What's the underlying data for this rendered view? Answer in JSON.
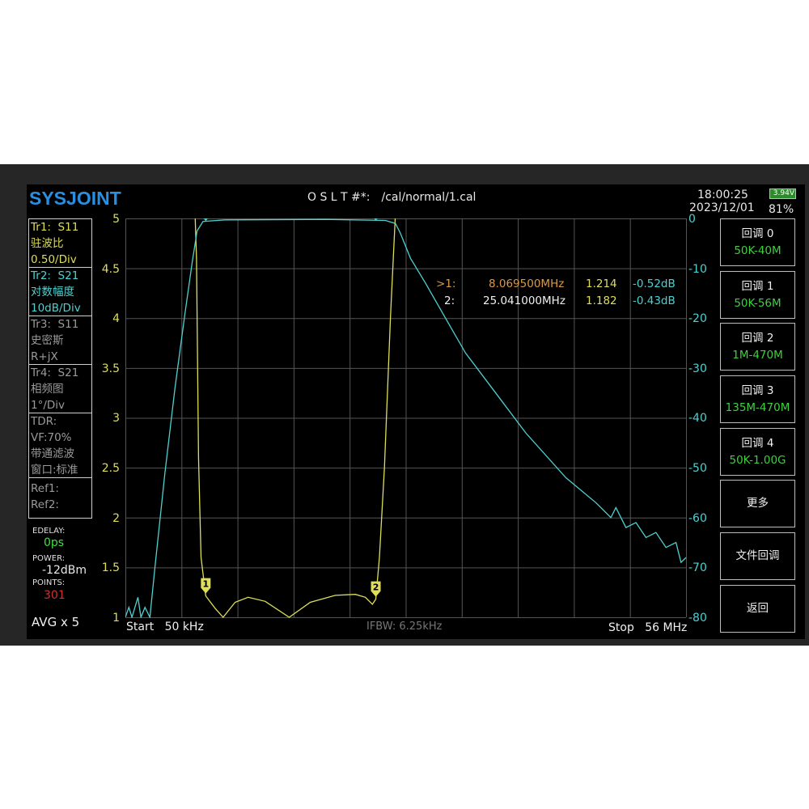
{
  "header": {
    "logo": "SYSJOINT",
    "cal_label": "O S L T #*:",
    "cal_file": "/cal/normal/1.cal",
    "time": "18:00:25",
    "date": "2023/12/01",
    "battery_voltage": "3.94V",
    "battery_percent": "81%"
  },
  "traces": [
    {
      "name": "Tr1:",
      "param": "S11",
      "format": "驻波比",
      "scale": "0.50/Div"
    },
    {
      "name": "Tr2:",
      "param": "S21",
      "format": "对数幅度",
      "scale": "10dB/Div"
    },
    {
      "name": "Tr3:",
      "param": "S11",
      "format": "史密斯",
      "scale": "R+jX"
    },
    {
      "name": "Tr4:",
      "param": "S21",
      "format": "相频图",
      "scale": "1°/Div"
    }
  ],
  "tdr": {
    "title": "TDR:",
    "vf": "VF:70%",
    "mode": "带通滤波",
    "window": "窗口:标准"
  },
  "refs": [
    "Ref1:",
    "Ref2:"
  ],
  "status": {
    "edelay_label": "EDELAY:",
    "edelay": "0ps",
    "power_label": "POWER:",
    "power": "-12dBm",
    "points_label": "POINTS:",
    "points": "301",
    "avg": "AVG x 5"
  },
  "markers": [
    {
      "id": ">1:",
      "freq_a": "8.069",
      "freq_b": "500MHz",
      "swr": "1.214",
      "s21": "-0.52dB",
      "label": "1"
    },
    {
      "id": "2:",
      "freq_a": "25.041",
      "freq_b": "000MHz",
      "swr": "1.182",
      "s21": "-0.43dB",
      "label": "2"
    }
  ],
  "footer": {
    "start_label": "Start",
    "start": "50 kHz",
    "ifbw": "IFBW: 6.25kHz",
    "stop_label": "Stop",
    "stop": "56 MHz"
  },
  "buttons": [
    {
      "label": "回调 0",
      "range": "50K-40M"
    },
    {
      "label": "回调 1",
      "range": "50K-56M"
    },
    {
      "label": "回调 2",
      "range": "1M-470M"
    },
    {
      "label": "回调 3",
      "range": "135M-470M"
    },
    {
      "label": "回调 4",
      "range": "50K-1.00G"
    },
    {
      "label": "更多"
    },
    {
      "label": "文件回调"
    },
    {
      "label": "返回"
    }
  ],
  "colors": {
    "s11": "#dede5a",
    "s21": "#4fd0d0",
    "marker1": "#d99a4a",
    "grid": "#555555",
    "logo": "#2a8fe0"
  },
  "chart_data": {
    "type": "line",
    "x_range_mhz": [
      0.05,
      56
    ],
    "x_divisions": 10,
    "left_axis": {
      "ticks": [
        "5",
        "4.5",
        "4",
        "3.5",
        "3",
        "2.5",
        "2",
        "1.5",
        "1"
      ],
      "range": [
        1,
        5
      ]
    },
    "right_axis": {
      "ticks": [
        "0",
        "-10",
        "-20",
        "-30",
        "-40",
        "-50",
        "-60",
        "-70",
        "-80"
      ],
      "range": [
        -80,
        0
      ]
    },
    "series": [
      {
        "name": "S11 SWR",
        "axis": "left",
        "points": [
          [
            0.05,
            5.3
          ],
          [
            7.0,
            5.3
          ],
          [
            7.15,
            4.6
          ],
          [
            7.35,
            2.6
          ],
          [
            7.6,
            1.6
          ],
          [
            8.07,
            1.214
          ],
          [
            9,
            1.09
          ],
          [
            9.8,
            1.0
          ],
          [
            11,
            1.15
          ],
          [
            12.3,
            1.2
          ],
          [
            14,
            1.16
          ],
          [
            16.4,
            1.0
          ],
          [
            18.5,
            1.15
          ],
          [
            21,
            1.22
          ],
          [
            23,
            1.23
          ],
          [
            24,
            1.2
          ],
          [
            24.7,
            1.13
          ],
          [
            25.04,
            1.182
          ],
          [
            25.4,
            1.6
          ],
          [
            25.9,
            2.5
          ],
          [
            26.5,
            4
          ],
          [
            27,
            5.3
          ],
          [
            56,
            5.3
          ]
        ]
      },
      {
        "name": "S21 LogMag",
        "axis": "right",
        "points": [
          [
            0.05,
            -80
          ],
          [
            0.4,
            -78
          ],
          [
            0.7,
            -80
          ],
          [
            1.3,
            -76
          ],
          [
            1.6,
            -80
          ],
          [
            2,
            -78
          ],
          [
            2.5,
            -80
          ],
          [
            3,
            -70
          ],
          [
            4,
            -51
          ],
          [
            5,
            -34
          ],
          [
            6,
            -19
          ],
          [
            6.7,
            -9
          ],
          [
            7.2,
            -2.5
          ],
          [
            7.8,
            -0.6
          ],
          [
            10,
            -0.3
          ],
          [
            20,
            -0.2
          ],
          [
            26,
            -0.4
          ],
          [
            27,
            -1
          ],
          [
            27.5,
            -3
          ],
          [
            28.5,
            -8
          ],
          [
            30,
            -13
          ],
          [
            32,
            -20
          ],
          [
            34,
            -27
          ],
          [
            37,
            -35
          ],
          [
            40,
            -43
          ],
          [
            44,
            -52
          ],
          [
            47,
            -57
          ],
          [
            48.5,
            -60
          ],
          [
            49,
            -58
          ],
          [
            50,
            -62
          ],
          [
            51,
            -61
          ],
          [
            52,
            -64
          ],
          [
            53,
            -63
          ],
          [
            54,
            -66
          ],
          [
            55,
            -65
          ],
          [
            55.5,
            -69
          ],
          [
            56,
            -68
          ]
        ]
      }
    ]
  }
}
